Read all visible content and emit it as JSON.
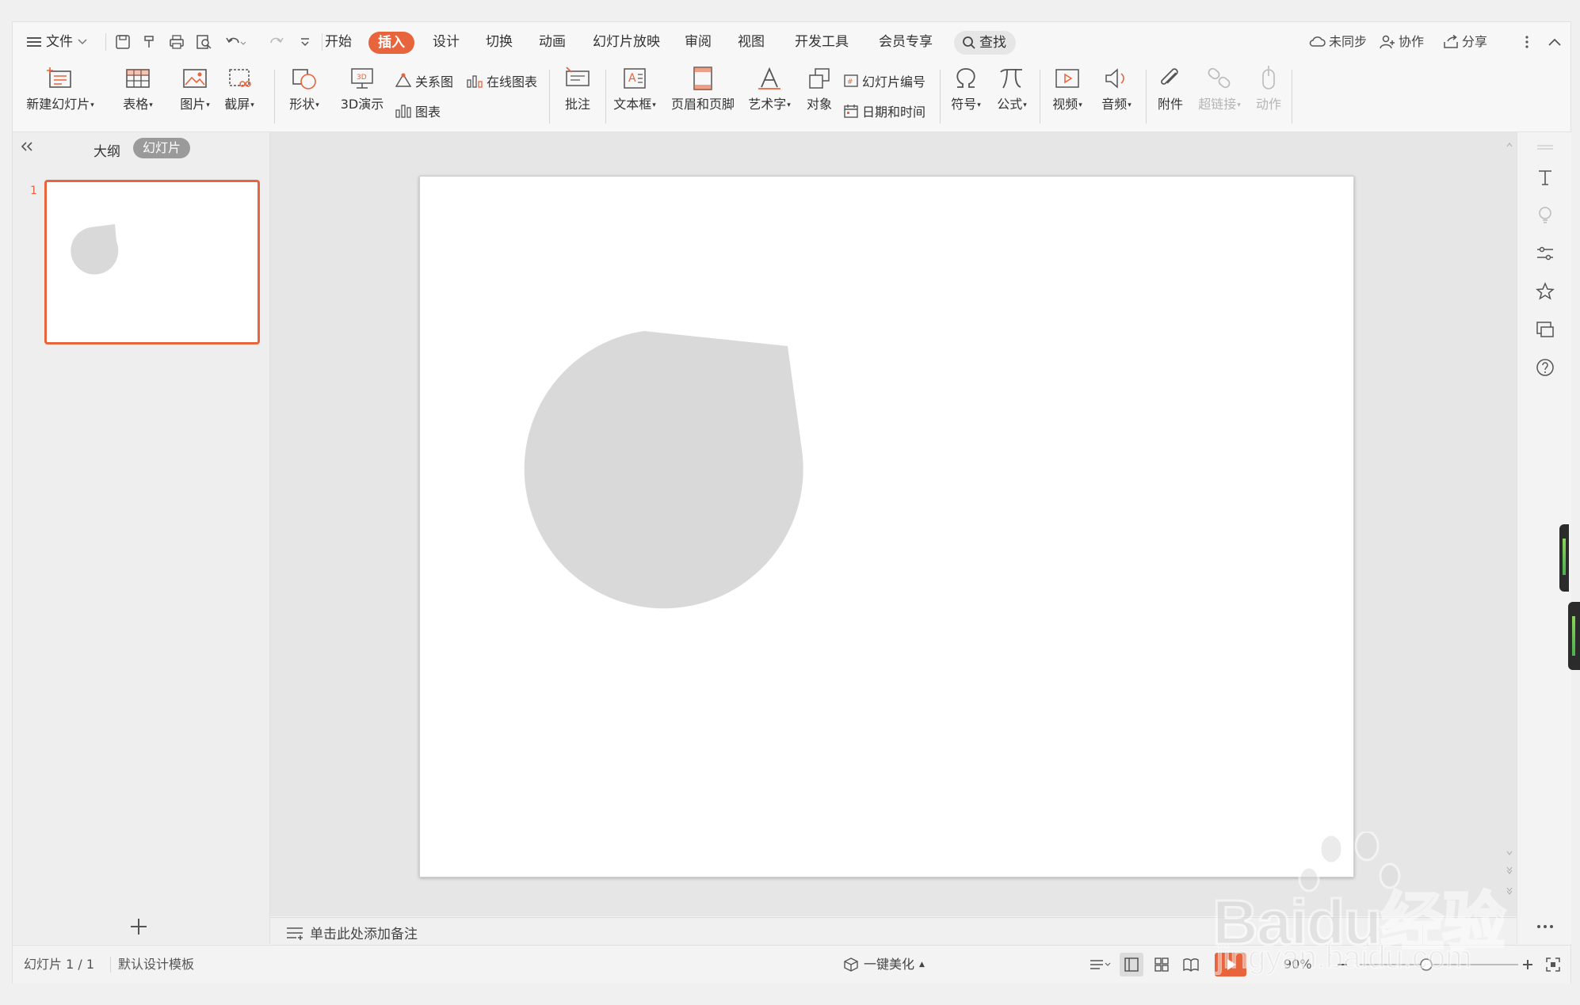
{
  "menubar": {
    "file_label": "文件",
    "tabs": [
      "开始",
      "插入",
      "设计",
      "切换",
      "动画",
      "幻灯片放映",
      "审阅",
      "视图",
      "开发工具",
      "会员专享"
    ],
    "active_tab": "插入",
    "search_label": "查找",
    "sync_label": "未同步",
    "collab_label": "协作",
    "share_label": "分享"
  },
  "ribbon": {
    "new_slide": "新建幻灯片",
    "table": "表格",
    "picture": "图片",
    "screenshot": "截屏",
    "shape": "形状",
    "demo3d": "3D演示",
    "relation": "关系图",
    "online_chart": "在线图表",
    "chart": "图表",
    "comment": "批注",
    "textbox": "文本框",
    "header_footer": "页眉和页脚",
    "wordart": "艺术字",
    "object": "对象",
    "slide_number": "幻灯片编号",
    "datetime": "日期和时间",
    "symbol": "符号",
    "formula": "公式",
    "video": "视频",
    "audio": "音频",
    "attachment": "附件",
    "hyperlink": "超链接",
    "action": "动作",
    "accent_color": "#e8643c"
  },
  "left_panel": {
    "tab_outline": "大纲",
    "tab_slides": "幻灯片",
    "slide_number": "1",
    "add_icon": "plus-icon"
  },
  "slide": {
    "shape_type": "teardrop",
    "shape_color": "#d9d9d9"
  },
  "notes": {
    "placeholder": "单击此处添加备注"
  },
  "statusbar": {
    "slide_info": "幻灯片 1 / 1",
    "template": "默认设计模板",
    "beautify": "一键美化",
    "zoom": "90%"
  },
  "watermark": {
    "brand": "Baidu经验",
    "url": "jingyan.baidu.com"
  }
}
